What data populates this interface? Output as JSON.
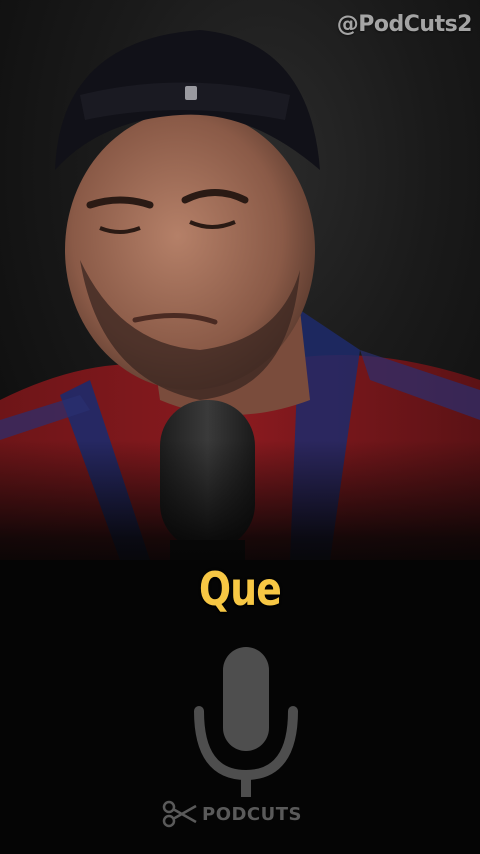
{
  "watermark": {
    "handle": "@PodCuts2"
  },
  "caption": {
    "text": "Que",
    "color": "#f7c744"
  },
  "logo": {
    "icon": "microphone-icon",
    "brand_icon": "scissors-icon",
    "brand_text": "PODCUTS",
    "color": "#5a5a5a"
  },
  "video": {
    "content": "podcast-speaker-frame"
  }
}
